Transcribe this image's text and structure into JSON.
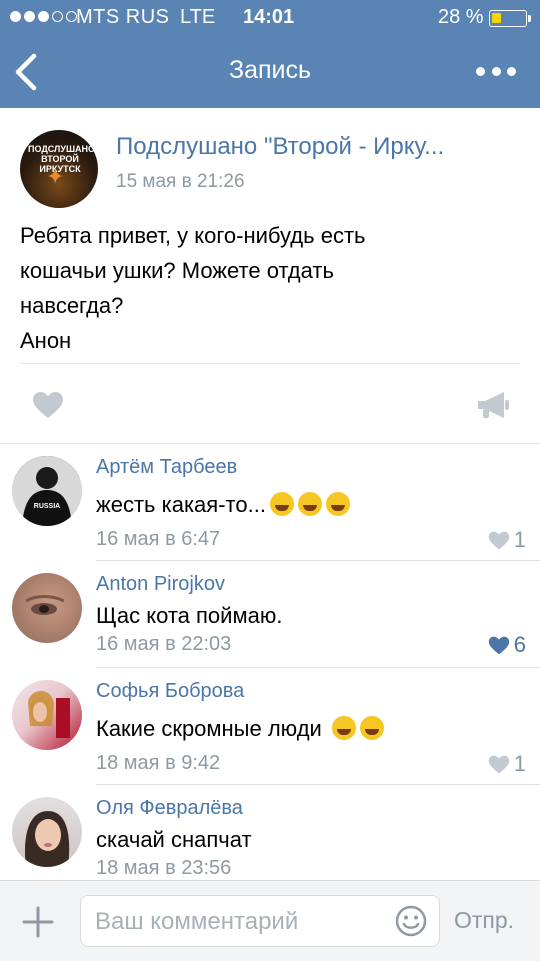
{
  "status_bar": {
    "carrier": "MTS RUS",
    "network": "LTE",
    "time": "14:01",
    "battery_percent": "28 %",
    "battery_level": 0.28,
    "signal_bars_filled": 3,
    "signal_bars_total": 5
  },
  "nav": {
    "title": "Запись",
    "back_icon": "chevron-left-icon",
    "more_icon": "more-dots-icon"
  },
  "post": {
    "author": "Подслушано \"Второй - Ирку...",
    "avatar_text": "ПОДСЛУШАНО\nВТОРОЙ ИРКУТСК",
    "date": "15 мая в 21:26",
    "text": "Ребята привет, у кого-нибудь есть\nкошачьи ушки? Можете отдать\nнавсегда?\nАнон"
  },
  "comments": [
    {
      "name": "Артём Тарбеев",
      "text": "жесть какая-то...",
      "emojis": [
        "laughing",
        "laughing",
        "laughing"
      ],
      "date": "16 мая в 6:47",
      "likes": "1",
      "liked": false
    },
    {
      "name": "Anton Pirojkov",
      "text": "Щас кота поймаю.",
      "emojis": [],
      "date": "16 мая в 22:03",
      "likes": "6",
      "liked": true
    },
    {
      "name": "Софья Боброва",
      "text": "Какие скромные люди",
      "emojis": [
        "smirk",
        "grimace"
      ],
      "date": "18 мая в 9:42",
      "likes": "1",
      "liked": false
    },
    {
      "name": "Оля Февралёва",
      "text": "скачай снапчат",
      "emojis": [],
      "date": "18 мая в 23:56",
      "likes": "",
      "liked": false
    }
  ],
  "composer": {
    "placeholder": "Ваш комментарий",
    "send_label": "Отпр.",
    "attach_icon": "plus-icon",
    "emoji_icon": "smiley-icon"
  },
  "colors": {
    "header_blue": "#5a84b4",
    "link_blue": "#4a76a8",
    "meta_gray": "#8e99a4",
    "battery_yellow": "#f6d600"
  }
}
